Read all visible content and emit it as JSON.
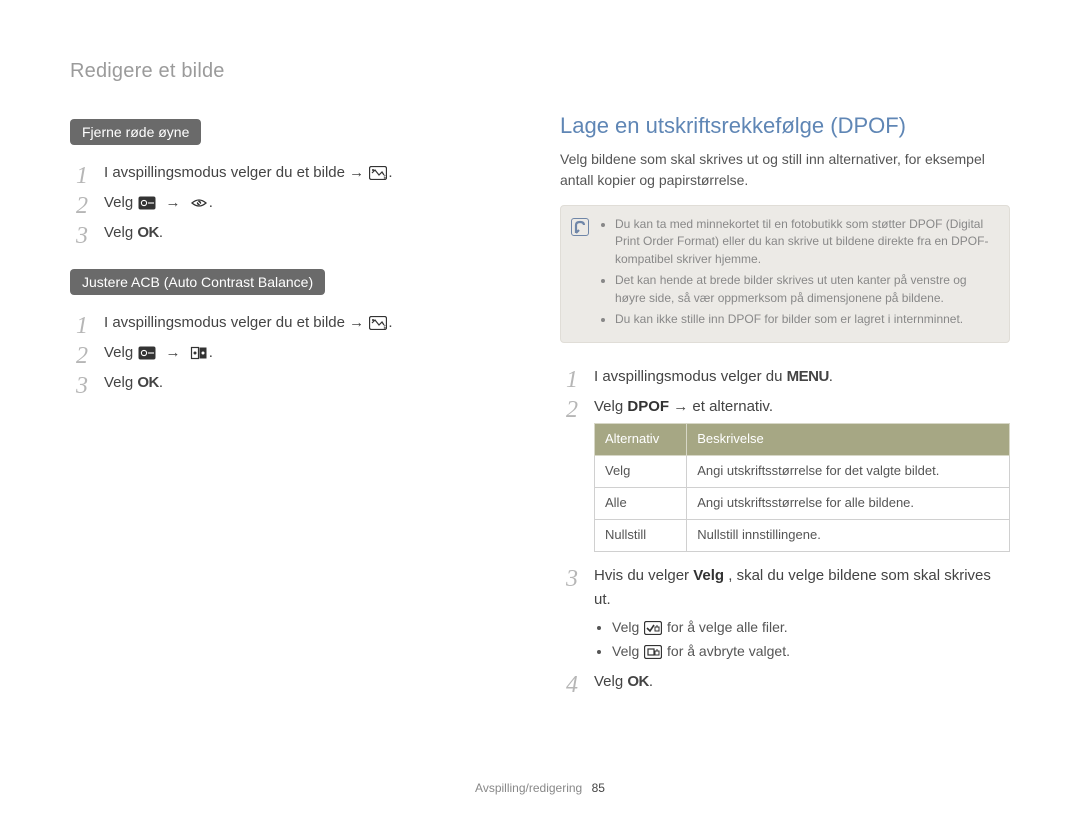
{
  "breadcrumb": "Redigere et bilde",
  "left": {
    "section1_label": "Fjerne røde øyne",
    "s1_step1": "I avspillingsmodus velger du et bilde →",
    "s1_step2_pre": "Velg ",
    "s1_step2_arrow": "→",
    "s1_step3_pre": "Velg ",
    "ok": "OK",
    "section2_label": "Justere ACB (Auto Contrast Balance)",
    "s2_step1": "I avspillingsmodus velger du et bilde →",
    "s2_step2_pre": "Velg ",
    "s2_step2_arrow": "→",
    "s2_step3_pre": "Velg "
  },
  "right": {
    "title": "Lage en utskriftsrekkefølge (DPOF)",
    "intro": "Velg bildene som skal skrives ut og still inn alternativer, for eksempel antall kopier og papirstørrelse.",
    "notes": [
      "Du kan ta med minnekortet til en fotobutikk som støtter DPOF (Digital Print Order Format) eller du kan skrive ut bildene direkte fra en DPOF-kompatibel skriver hjemme.",
      "Det kan hende at brede bilder skrives ut uten kanter på venstre og høyre side, så vær oppmerksom på dimensjonene på bildene.",
      "Du kan ikke stille inn DPOF for bilder som er lagret i internminnet."
    ],
    "step1_pre": "I avspillingsmodus velger du ",
    "menu": "MENU",
    "step2_pre": "Velg ",
    "step2_bold": "DPOF",
    "step2_post": " → et alternativ.",
    "table": {
      "h1": "Alternativ",
      "h2": "Beskrivelse",
      "rows": [
        {
          "a": "Velg",
          "b": "Angi utskriftsstørrelse for det valgte bildet."
        },
        {
          "a": "Alle",
          "b": "Angi utskriftsstørrelse for alle bildene."
        },
        {
          "a": "Nullstill",
          "b": "Nullstill innstillingene."
        }
      ]
    },
    "step3_pre": "Hvis du velger ",
    "step3_bold": "Velg",
    "step3_post": ", skal du velge bildene som skal skrives ut.",
    "bullet1_pre": "Velg ",
    "bullet1_post": " for å velge alle filer.",
    "bullet2_pre": "Velg ",
    "bullet2_post": " for å avbryte valget.",
    "step4_pre": "Velg ",
    "ok": "OK"
  },
  "footer": {
    "section": "Avspilling/redigering",
    "page": "85"
  }
}
